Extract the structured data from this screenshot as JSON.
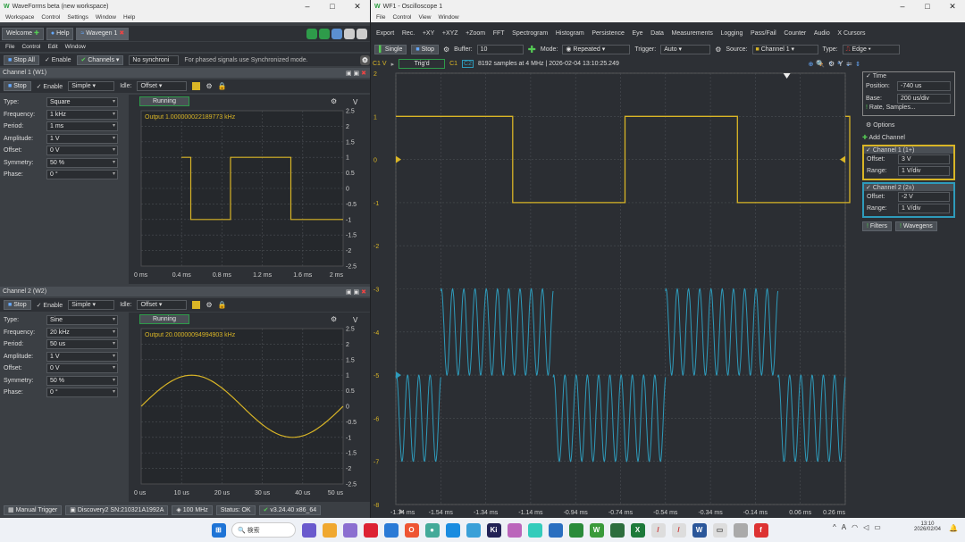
{
  "left_window": {
    "title": "WaveForms beta (new workspace)",
    "menu": [
      "Workspace",
      "Control",
      "Settings",
      "Window",
      "Help"
    ],
    "tabs": [
      "Welcome",
      "Help",
      "Wavegen 1"
    ],
    "sub_menu": [
      "File",
      "Control",
      "Edit",
      "Window"
    ],
    "toolbar": {
      "stop_all": "Stop All",
      "enable": "Enable",
      "channels": "Channels",
      "sync": "No synchroni",
      "hint": "For phased signals use Synchronized mode."
    },
    "ch1": {
      "title": "Channel 1 (W1)",
      "stop": "Stop",
      "enable": "Enable",
      "mode": "Simple",
      "idle_label": "Idle:",
      "idle": "Offset",
      "props": [
        {
          "k": "Type:",
          "v": "Square"
        },
        {
          "k": "Frequency:",
          "v": "1 kHz"
        },
        {
          "k": "Period:",
          "v": "1 ms"
        },
        {
          "k": "Amplitude:",
          "v": "1 V"
        },
        {
          "k": "Offset:",
          "v": "0 V"
        },
        {
          "k": "Symmetry:",
          "v": "50 %"
        },
        {
          "k": "Phase:",
          "v": "0 °"
        }
      ],
      "status": "Running",
      "output": "Output 1.000000022189773 kHz",
      "unit": "V",
      "yticks": [
        "2.5",
        "2",
        "1.5",
        "1",
        "0.5",
        "0",
        "-0.5",
        "-1",
        "-1.5",
        "-2",
        "-2.5"
      ],
      "xticks": [
        "0 ms",
        "0.4 ms",
        "0.8 ms",
        "1.2 ms",
        "1.6 ms",
        "2 ms"
      ]
    },
    "ch2": {
      "title": "Channel 2 (W2)",
      "stop": "Stop",
      "enable": "Enable",
      "mode": "Simple",
      "idle_label": "Idle:",
      "idle": "Offset",
      "props": [
        {
          "k": "Type:",
          "v": "Sine"
        },
        {
          "k": "Frequency:",
          "v": "20 kHz"
        },
        {
          "k": "Period:",
          "v": "50 us"
        },
        {
          "k": "Amplitude:",
          "v": "1 V"
        },
        {
          "k": "Offset:",
          "v": "0 V"
        },
        {
          "k": "Symmetry:",
          "v": "50 %"
        },
        {
          "k": "Phase:",
          "v": "0 °"
        }
      ],
      "status": "Running",
      "output": "Output 20.00000094994903 kHz",
      "unit": "V",
      "yticks": [
        "2.5",
        "2",
        "1.5",
        "1",
        "0.5",
        "0",
        "-0.5",
        "-1",
        "-1.5",
        "-2",
        "-2.5"
      ],
      "xticks": [
        "0 us",
        "10 us",
        "20 us",
        "30 us",
        "40 us",
        "50 us"
      ]
    },
    "statusbar": [
      "Manual Trigger",
      "Discovery2 SN:210321A1992A",
      "100 MHz",
      "Status: OK",
      "v3.24.40 x86_64"
    ]
  },
  "right_window": {
    "title": "WF1 - Oscilloscope 1",
    "menu": [
      "File",
      "Control",
      "View",
      "Window"
    ],
    "toolbar1": [
      "Export",
      "Rec.",
      "+XY",
      "+XYZ",
      "+Zoom",
      "FFT",
      "Spectrogram",
      "Histogram",
      "Persistence",
      "Eye",
      "Data",
      "Measurements",
      "Logging",
      "Pass/Fail",
      "Counter",
      "Audio",
      "X Cursors"
    ],
    "toolbar2": {
      "single": "Single",
      "stop": "Stop",
      "buffer_label": "Buffer:",
      "buffer": "10",
      "mode_label": "Mode:",
      "mode": "Repeated",
      "trigger_label": "Trigger:",
      "trigger": "Auto",
      "source_label": "Source:",
      "source": "Channel 1",
      "type_label": "Type:",
      "type": "Edge"
    },
    "info": {
      "unit": "C1 V",
      "status": "Trig'd",
      "c1": "C1",
      "c2": "C2",
      "text": "8192 samples at 4 MHz | 2026-02-04 13:10:25.249"
    },
    "yticks": [
      "2",
      "1",
      "0",
      "-1",
      "-2",
      "-3",
      "-4",
      "-5",
      "-6",
      "-7",
      "-8"
    ],
    "xticks": [
      "-1.74 ms",
      "-1.54 ms",
      "-1.34 ms",
      "-1.14 ms",
      "-0.94 ms",
      "-0.74 ms",
      "-0.54 ms",
      "-0.34 ms",
      "-0.14 ms",
      "0.06 ms",
      "0.26 ms"
    ],
    "panel": {
      "time_title": "Time",
      "position_label": "Position:",
      "position": "-740 us",
      "base_label": "Base:",
      "base": "200 us/div",
      "rate": "Rate, Samples...",
      "options": "Options",
      "add_channel": "Add Channel",
      "ch1_title": "Channel 1 (1+)",
      "ch1_offset_label": "Offset:",
      "ch1_offset": "3 V",
      "ch1_range_label": "Range:",
      "ch1_range": "1 V/div",
      "ch2_title": "Channel 2 (2±)",
      "ch2_offset_label": "Offset:",
      "ch2_offset": "-2 V",
      "ch2_range_label": "Range:",
      "ch2_range": "1 V/div",
      "filters": "Filters",
      "wavegens": "Wavegens"
    }
  },
  "taskbar": {
    "search": "検索",
    "time": "13:10",
    "date": "2026/02/04"
  },
  "colors": {
    "ch1": "#d9b526",
    "ch2": "#2e9bbb",
    "bg": "#2b2e33"
  }
}
